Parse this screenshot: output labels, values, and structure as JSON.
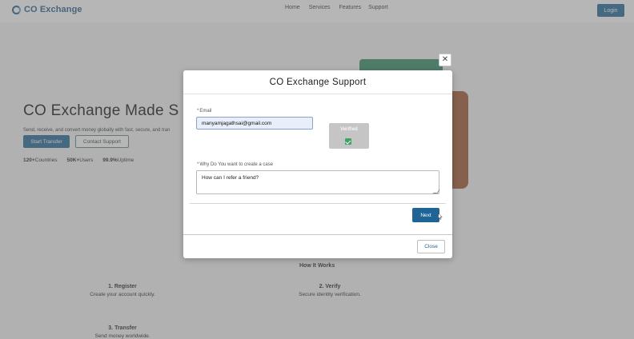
{
  "navbar": {
    "brand": "CO Exchange",
    "links": [
      "Home",
      "Services",
      "Features",
      "Support"
    ],
    "login_label": "Login"
  },
  "hero": {
    "title": "CO Exchange Made S",
    "subtitle": "Send, receive, and convert money globally with fast, secure, and tran",
    "start_label": "Start Transfer",
    "contact_label": "Contact Support",
    "stats": [
      {
        "value": "120+",
        "label": "Countries"
      },
      {
        "value": "50K+",
        "label": "Users"
      },
      {
        "value": "99.9%",
        "label": "Uptime"
      }
    ]
  },
  "how": {
    "title": "How It Works",
    "steps": [
      {
        "title": "1. Register",
        "desc": "Create your account quickly."
      },
      {
        "title": "2. Verify",
        "desc": "Secure identity verification."
      },
      {
        "title": "3. Transfer",
        "desc": "Send money worldwide."
      }
    ]
  },
  "modal": {
    "title": "CO Exchange Support",
    "close_x": "✕",
    "email_label": "Email",
    "email_value": "manyamjagathsai@gmail.com",
    "verified_label": "Verified",
    "why_label": "Why Do You want to create a case",
    "why_value": "How can I refer a friend?",
    "next_label": "Next",
    "close_label": "Close"
  },
  "colors": {
    "primary": "#1f6496",
    "brand": "#1e5a8f",
    "verified_bg": "#c5c5c5",
    "check": "#3fa461",
    "required": "#c23934"
  }
}
